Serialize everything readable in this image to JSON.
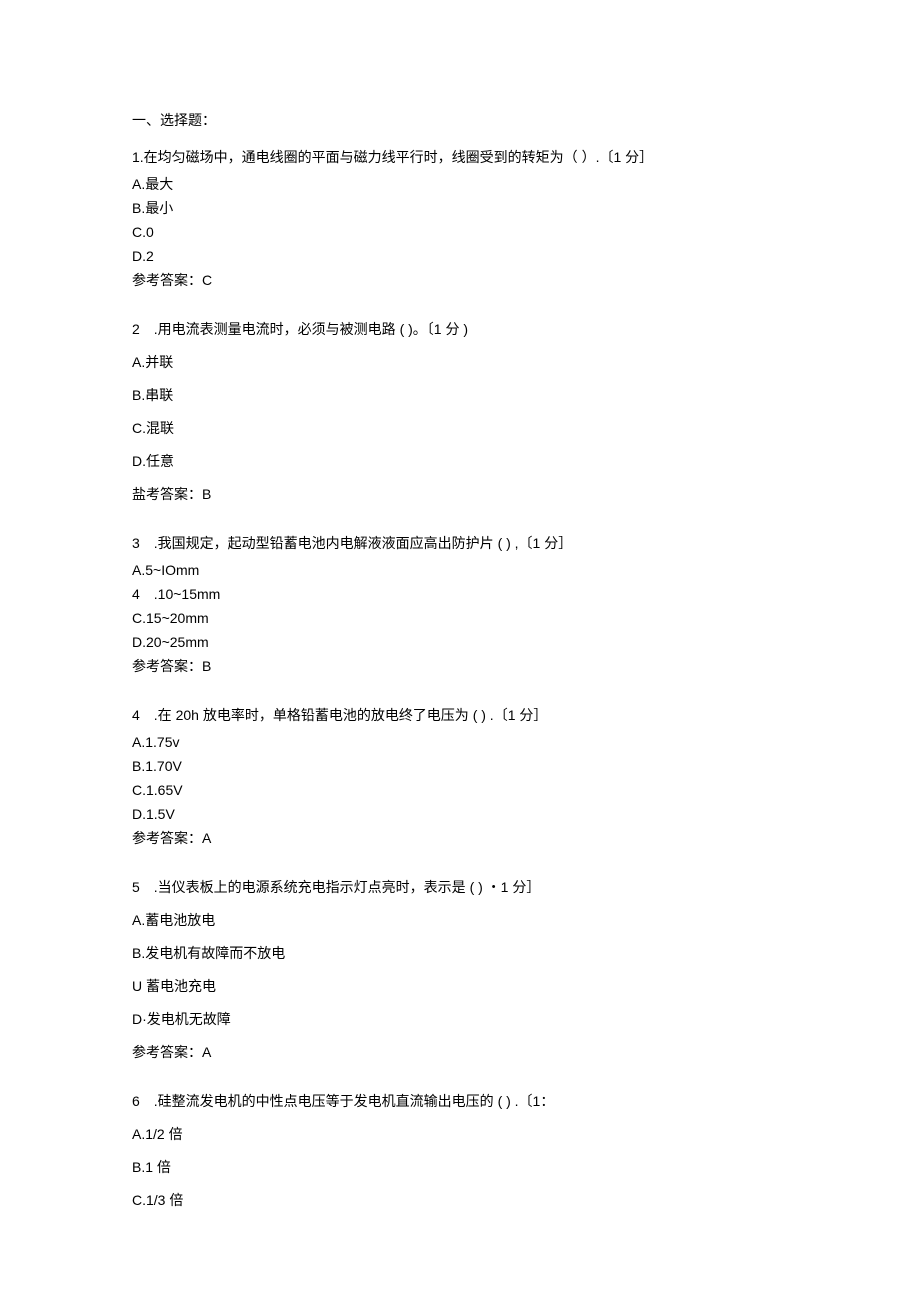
{
  "section_heading": "一、选择题：",
  "q1": {
    "stem": "1.在均匀磁场中，通电线圈的平面与磁力线平行时，线圈受到的转矩为（ ）.〔1 分］",
    "a": "A.最大",
    "b": "B.最小",
    "c": "C.0",
    "d": "D.2",
    "ans": "参考答案：C"
  },
  "q2": {
    "stem": "2　.用电流表测量电流时，必须与被测电路 ( )。〔1 分 )",
    "a": "A.并联",
    "b": "B.串联",
    "c": "C.混联",
    "d": "D.任意",
    "ans": "盐考答案：B"
  },
  "q3": {
    "stem": "3　.我国规定，起动型铅蓄电池内电解液液面应高出防护片 ( ) ,〔1 分］",
    "a": "A.5~IOmm",
    "b": "4　.10~15mm",
    "c": "C.15~20mm",
    "d": "D.20~25mm",
    "ans": "参考答案：B"
  },
  "q4": {
    "stem": "4　.在 20h 放电率时，单格铅蓄电池的放电终了电压为 ( ) .〔1 分］",
    "a": "A.1.75v",
    "b": "B.1.70V",
    "c": "C.1.65V",
    "d": "D.1.5V",
    "ans": "参考答案：A"
  },
  "q5": {
    "stem": "5　.当仪表板上的电源系统充电指示灯点亮时，表示是 ( )  ・1 分］",
    "a": "A.蓄电池放电",
    "b": "B.发电机有故障而不放电",
    "c": "U 蓄电池充电",
    "d": "D·发电机无故障",
    "ans": "参考答案：A"
  },
  "q6": {
    "stem": "6　.硅整流发电机的中性点电压等于发电机直流输出电压的 ( ) .〔1：",
    "a": "A.1/2 倍",
    "b": "B.1 倍",
    "c": "C.1/3 倍"
  }
}
